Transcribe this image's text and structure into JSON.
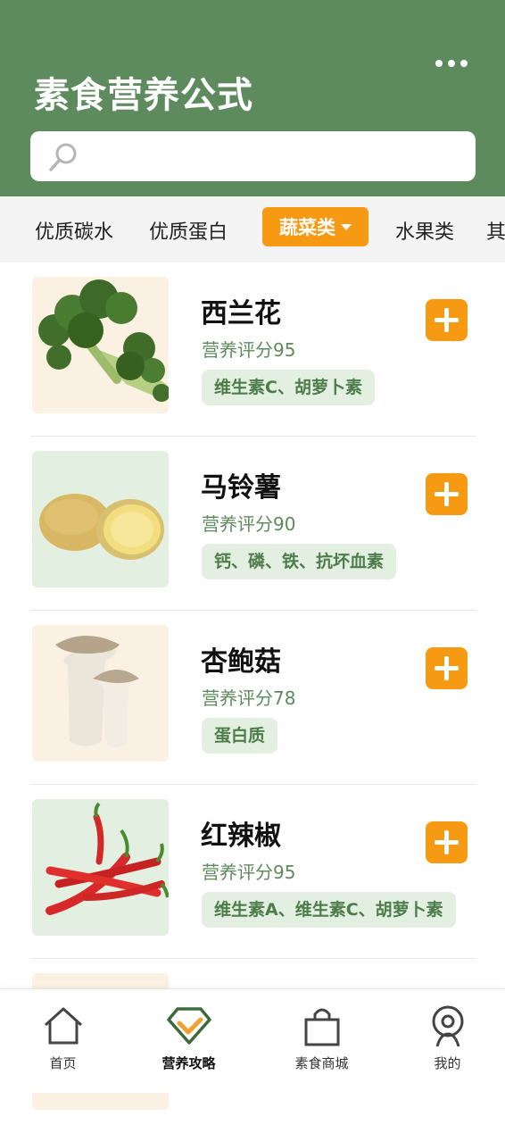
{
  "header": {
    "title": "素食营养公式"
  },
  "search": {
    "placeholder": ""
  },
  "categories": [
    {
      "label": "优质碳水"
    },
    {
      "label": "优质蛋白"
    },
    {
      "label": "蔬菜类",
      "active": true
    },
    {
      "label": "水果类"
    },
    {
      "label": "其"
    }
  ],
  "items": [
    {
      "name": "西兰花",
      "score": "营养评分95",
      "tag": "维生素C、胡萝卜素",
      "image": "broccoli"
    },
    {
      "name": "马铃薯",
      "score": "营养评分90",
      "tag": "钙、磷、铁、抗坏血素",
      "image": "potato"
    },
    {
      "name": "杏鲍菇",
      "score": "营养评分78",
      "tag": "蛋白质",
      "image": "king-oyster-mushroom"
    },
    {
      "name": "红辣椒",
      "score": "营养评分95",
      "tag": "维生素A、维生素C、胡萝卜素",
      "image": "red-chili"
    }
  ],
  "tabbar": {
    "tabs": [
      {
        "label": "首页",
        "icon": "home-icon"
      },
      {
        "label": "营养攻略",
        "icon": "diamond-check-icon",
        "active": true
      },
      {
        "label": "素食商城",
        "icon": "shopping-bag-icon"
      },
      {
        "label": "我的",
        "icon": "user-icon"
      }
    ]
  },
  "colors": {
    "primary_green": "#5e8b5d",
    "accent_orange": "#f79a13",
    "tag_bg": "#e3efe0"
  }
}
